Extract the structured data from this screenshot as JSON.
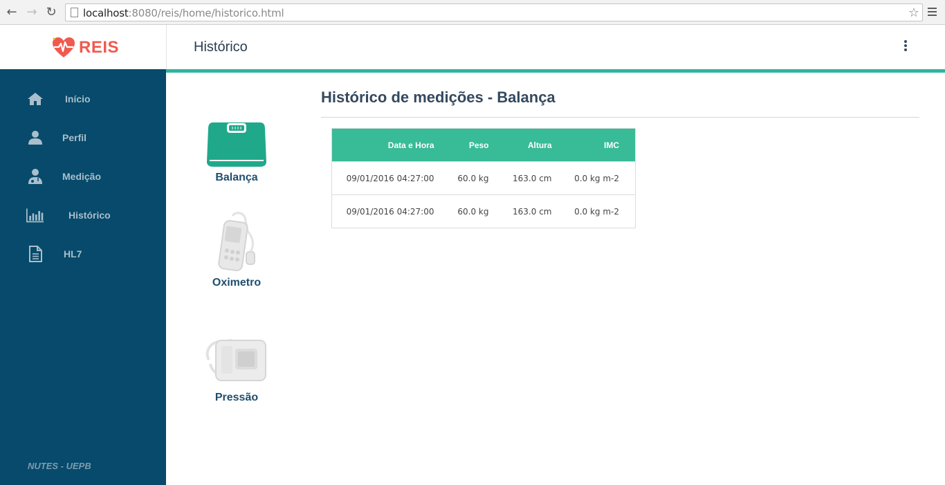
{
  "browser": {
    "url_host": "localhost",
    "url_rest": ":8080/reis/home/historico.html"
  },
  "app": {
    "logo_text": "REIS",
    "page_title": "Histórico"
  },
  "sidebar": {
    "items": [
      {
        "label": "Início",
        "icon": "home-icon"
      },
      {
        "label": "Perfil",
        "icon": "user-icon"
      },
      {
        "label": "Medição",
        "icon": "doctor-icon"
      },
      {
        "label": "Histórico",
        "icon": "bar-chart-icon"
      },
      {
        "label": "HL7",
        "icon": "document-icon"
      }
    ],
    "footer": "NUTES - UEPB"
  },
  "devices": [
    {
      "label": "Balança",
      "icon": "scale-icon",
      "active": true
    },
    {
      "label": "Oximetro",
      "icon": "oximeter-icon",
      "active": false
    },
    {
      "label": "Pressão",
      "icon": "blood-pressure-icon",
      "active": false
    }
  ],
  "main": {
    "title": "Histórico de medições - Balança",
    "table": {
      "headers": [
        "Data e Hora",
        "Peso",
        "Altura",
        "IMC"
      ],
      "rows": [
        [
          "09/01/2016 04:27:00",
          "60.0 kg",
          "163.0 cm",
          "0.0 kg m-2"
        ],
        [
          "09/01/2016 04:27:00",
          "60.0 kg",
          "163.0 cm",
          "0.0 kg m-2"
        ]
      ]
    }
  },
  "colors": {
    "sidebar_bg": "#074a6b",
    "accent_teal": "#2fb5a0",
    "table_header": "#38bb97",
    "logo_red": "#ef5a4f"
  }
}
